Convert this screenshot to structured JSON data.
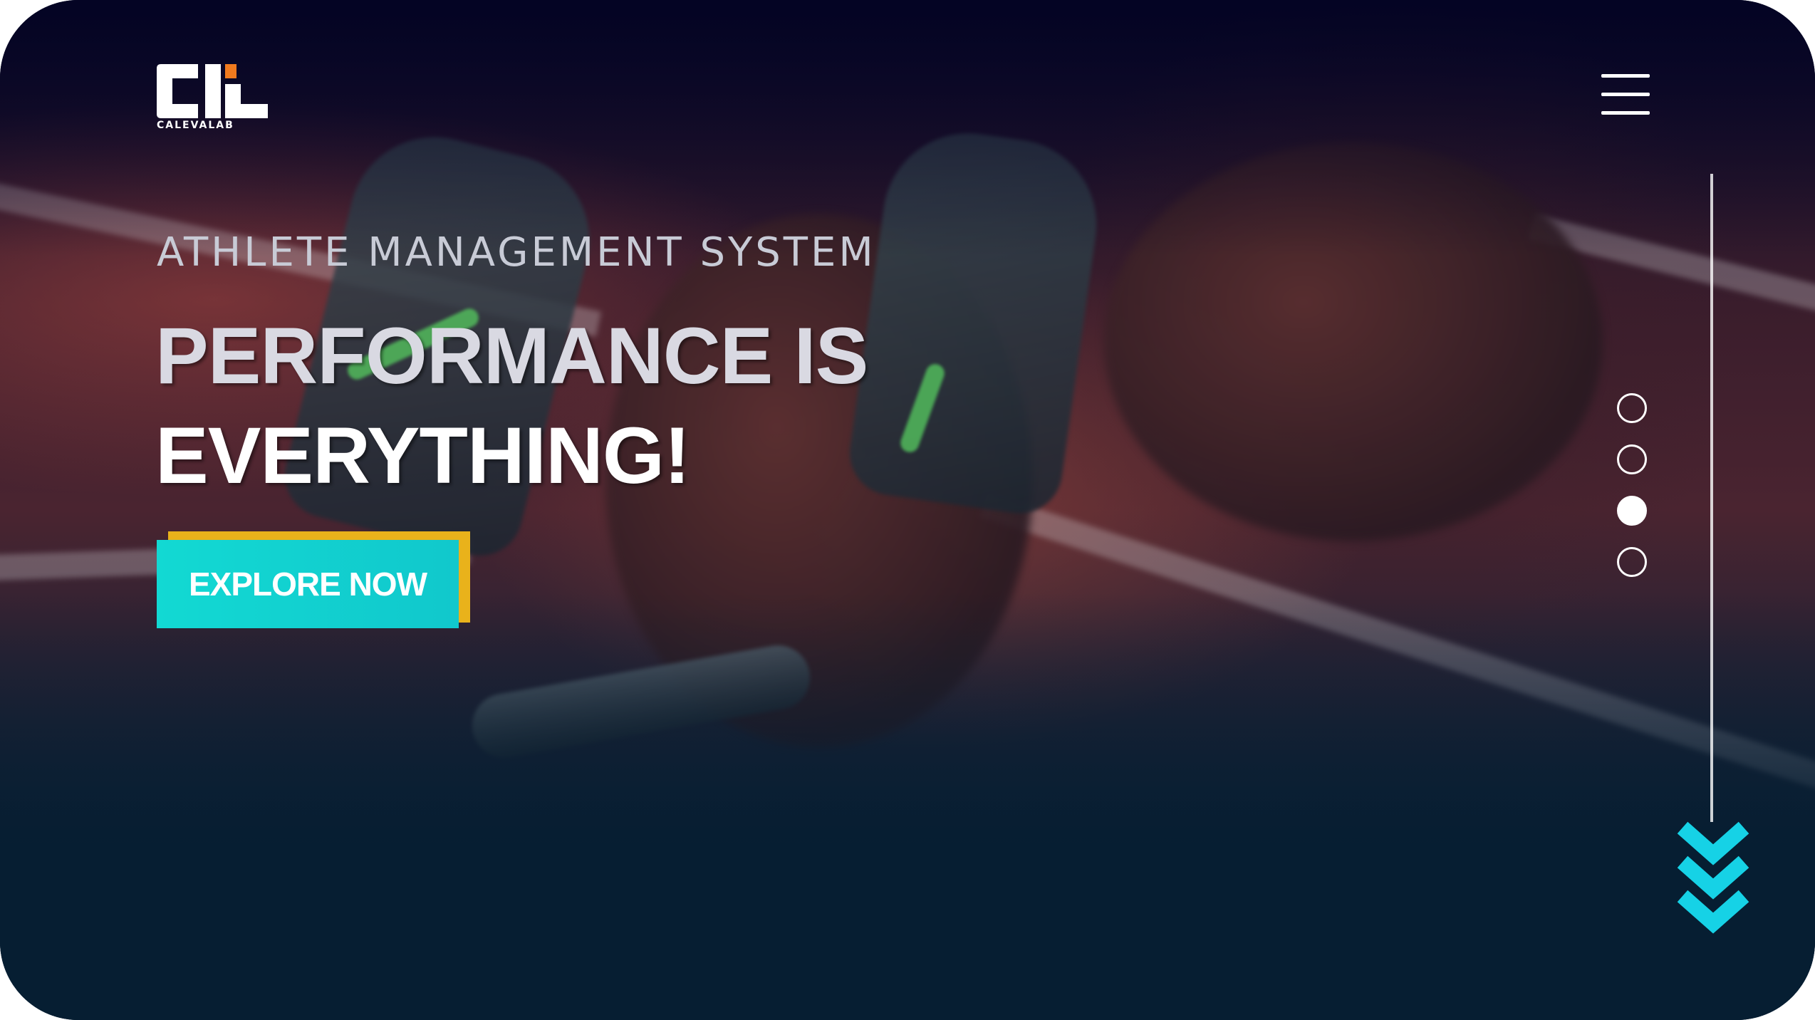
{
  "brand": {
    "logo_text": "CALEVALAB",
    "logo_icon": "calevalab-logo-icon",
    "accent_color": "#f07a1e"
  },
  "header": {
    "menu_icon": "hamburger-menu-icon"
  },
  "hero": {
    "kicker": "ATHLETE MANAGEMENT SYSTEM",
    "headline_line1": "PERFORMANCE IS",
    "headline_line2": "EVERYTHING!",
    "cta_label": "EXPLORE NOW",
    "cta_color": "#12d9d3",
    "cta_shadow_color": "#e9b21b"
  },
  "slider": {
    "count": 4,
    "active_index": 2
  },
  "scroll": {
    "icon": "triple-chevron-down-icon",
    "color": "#16d2e6"
  }
}
